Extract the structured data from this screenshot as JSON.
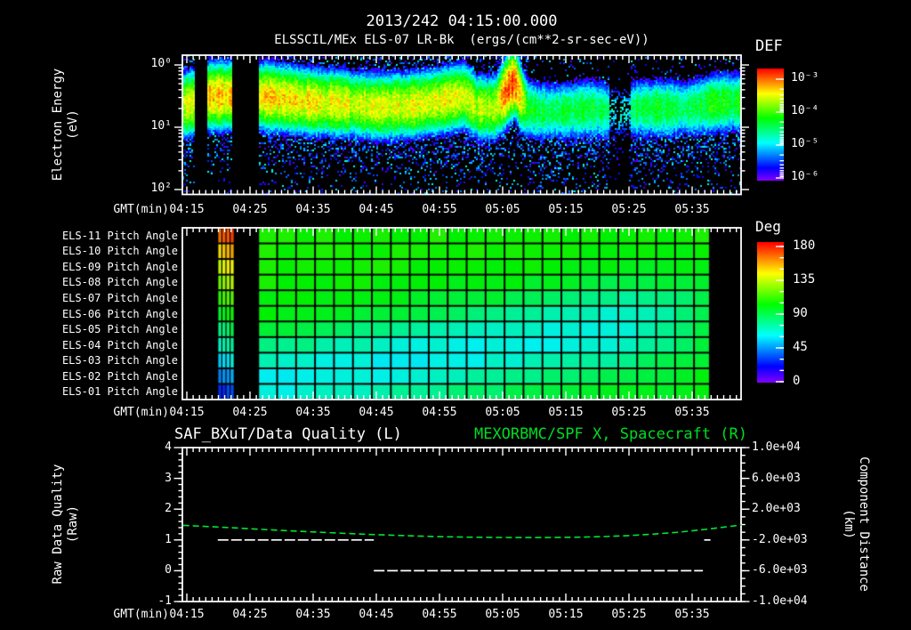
{
  "header": {
    "title": "2013/242 04:15:00.000",
    "subtitle": "ELSSCIL/MEx ELS-07 LR-Bk  (ergs/(cm**2-sr-sec-eV))"
  },
  "colors": {
    "background": "#000000",
    "text": "#ffffff",
    "title_green": "#00dd22",
    "distance_line": "#00e532",
    "quality_line": "#ffffff"
  },
  "time_axis": {
    "label": "GMT(min)",
    "ticks": [
      "04:15",
      "04:25",
      "04:35",
      "04:45",
      "04:55",
      "05:05",
      "05:15",
      "05:25",
      "05:35"
    ]
  },
  "spectrogram_panel": {
    "ylabel_line1": "Electron Energy",
    "ylabel_line2": "(eV)",
    "yticks": [
      "10²",
      "10¹",
      "10⁰"
    ],
    "colorbar_title": "DEF",
    "colorbar_ticks": [
      "10⁻³",
      "10⁻⁴",
      "10⁻⁵",
      "10⁻⁶"
    ]
  },
  "pitch_panel": {
    "rows": [
      "ELS-11 Pitch Angle",
      "ELS-10 Pitch Angle",
      "ELS-09 Pitch Angle",
      "ELS-08 Pitch Angle",
      "ELS-07 Pitch Angle",
      "ELS-06 Pitch Angle",
      "ELS-05 Pitch Angle",
      "ELS-04 Pitch Angle",
      "ELS-03 Pitch Angle",
      "ELS-02 Pitch Angle",
      "ELS-01 Pitch Angle"
    ],
    "colorbar_title": "Deg",
    "colorbar_ticks": [
      "180",
      "135",
      "90",
      "45",
      "0"
    ]
  },
  "bottom_panel": {
    "title_left": "SAF_BXuT/Data Quality (L)",
    "title_right": "MEXORBMC/SPF X, Spacecraft (R)",
    "left_axis": {
      "label_line1": "Raw Data Quality",
      "label_line2": "(Raw)",
      "ticks": [
        "4",
        "3",
        "2",
        "1",
        "0",
        "-1"
      ]
    },
    "right_axis": {
      "label_line1": "Component Distance",
      "label_line2": "(km)",
      "ticks": [
        "1.0e+04",
        "6.0e+03",
        "2.0e+03",
        "-2.0e+03",
        "-6.0e+03",
        "-1.0e+04"
      ]
    }
  },
  "chart_data": [
    {
      "type": "heatmap",
      "title": "ELSSCIL/MEx ELS-07 LR-Bk electron energy spectrogram",
      "units": "ergs/(cm**2-sr-sec-eV)",
      "x_axis": {
        "label": "GMT(min)",
        "start": "04:15",
        "end": "05:40",
        "tick_step_min": 10
      },
      "y_axis": {
        "label": "Electron Energy (eV)",
        "scale": "log",
        "range_log10": [
          0,
          2.16
        ]
      },
      "colorbar": {
        "title": "DEF",
        "range_log10": [
          -6,
          -3
        ]
      },
      "gaps_min": [
        [
          1.3,
          3.2
        ],
        [
          7.3,
          11.3
        ]
      ],
      "dim_bands_min": [
        [
          66.8,
          70.2,
          0.55
        ]
      ],
      "sparse_top_after_min": 54,
      "band_sigma_decades": 0.4,
      "band_profile": [
        [
          -0.7,
          1.35,
          -3.7
        ],
        [
          1.3,
          1.4,
          -3.7
        ],
        [
          3.2,
          1.5,
          -3.5
        ],
        [
          7.3,
          1.5,
          -3.55
        ],
        [
          11.3,
          1.5,
          -3.55
        ],
        [
          16,
          1.45,
          -3.6
        ],
        [
          20,
          1.4,
          -3.65
        ],
        [
          25,
          1.38,
          -3.75
        ],
        [
          30,
          1.33,
          -3.8
        ],
        [
          35,
          1.35,
          -3.75
        ],
        [
          40,
          1.42,
          -3.7
        ],
        [
          44,
          1.5,
          -3.7
        ],
        [
          46,
          1.32,
          -3.9
        ],
        [
          48.7,
          1.3,
          -3.9
        ],
        [
          49.8,
          1.45,
          -3.5
        ],
        [
          51,
          1.65,
          -3.12
        ],
        [
          52,
          1.72,
          -3.3
        ],
        [
          52.8,
          1.5,
          -3.6
        ],
        [
          54,
          1.3,
          -4.3
        ],
        [
          56,
          1.25,
          -4.5
        ],
        [
          60,
          1.25,
          -4.55
        ],
        [
          64,
          1.3,
          -4.45
        ],
        [
          67,
          1.25,
          -4.7
        ],
        [
          69.5,
          1.25,
          -4.7
        ],
        [
          71,
          1.3,
          -4.5
        ],
        [
          75,
          1.3,
          -4.4
        ],
        [
          79,
          1.3,
          -4.55
        ],
        [
          82,
          1.35,
          -4.35
        ],
        [
          85,
          1.4,
          -4.3
        ],
        [
          87.8,
          1.4,
          -4.4
        ]
      ]
    },
    {
      "type": "heatmap",
      "title": "ELS pitch angle panels (ELS-11 top to ELS-01 bottom)",
      "rows": [
        "ELS-11",
        "ELS-10",
        "ELS-09",
        "ELS-08",
        "ELS-07",
        "ELS-06",
        "ELS-05",
        "ELS-04",
        "ELS-03",
        "ELS-02",
        "ELS-01"
      ],
      "colorbar": {
        "title": "Deg",
        "range": [
          0,
          180
        ]
      },
      "main_region_min": [
        11.3,
        82.8
      ],
      "cell_minutes": 3,
      "angle_model": {
        "base": 103,
        "row_slope": 0.5,
        "dip_amp": 38,
        "dip_sigma": 2.0,
        "dip_row_start": 9.3,
        "dip_row_end": 5.0,
        "fade_after": 0.8
      },
      "sweep_strip": {
        "range_min": [
          4.9,
          7.5
        ],
        "columns": 4,
        "angle_top": 165,
        "angle_bottom": 30
      }
    },
    {
      "type": "line",
      "title_left": "SAF_BXuT/Data Quality (L)",
      "title_right": "MEXORBMC/SPF X, Spacecraft (R)",
      "left_axis": {
        "label": "Raw Data Quality (Raw)",
        "range": [
          -1,
          4
        ]
      },
      "right_axis": {
        "label": "Component Distance (km)",
        "range": [
          -10000,
          10000
        ]
      },
      "quality_segments": [
        {
          "start_min": 4.9,
          "end_min": 29.6,
          "value": 1
        },
        {
          "start_min": 29.6,
          "end_min": 81.7,
          "value": 0
        },
        {
          "start_min": 81.9,
          "end_min": 82.9,
          "value": 1
        }
      ],
      "distance_km_points": [
        [
          -0.6,
          -100
        ],
        [
          5,
          -320
        ],
        [
          10,
          -540
        ],
        [
          15,
          -760
        ],
        [
          20,
          -960
        ],
        [
          25,
          -1150
        ],
        [
          30,
          -1320
        ],
        [
          35,
          -1460
        ],
        [
          40,
          -1570
        ],
        [
          45,
          -1640
        ],
        [
          50,
          -1675
        ],
        [
          55,
          -1685
        ],
        [
          58,
          -1680
        ],
        [
          62,
          -1640
        ],
        [
          66,
          -1560
        ],
        [
          70,
          -1430
        ],
        [
          74,
          -1240
        ],
        [
          78,
          -980
        ],
        [
          82,
          -640
        ],
        [
          85,
          -330
        ],
        [
          87.8,
          -60
        ]
      ]
    }
  ]
}
